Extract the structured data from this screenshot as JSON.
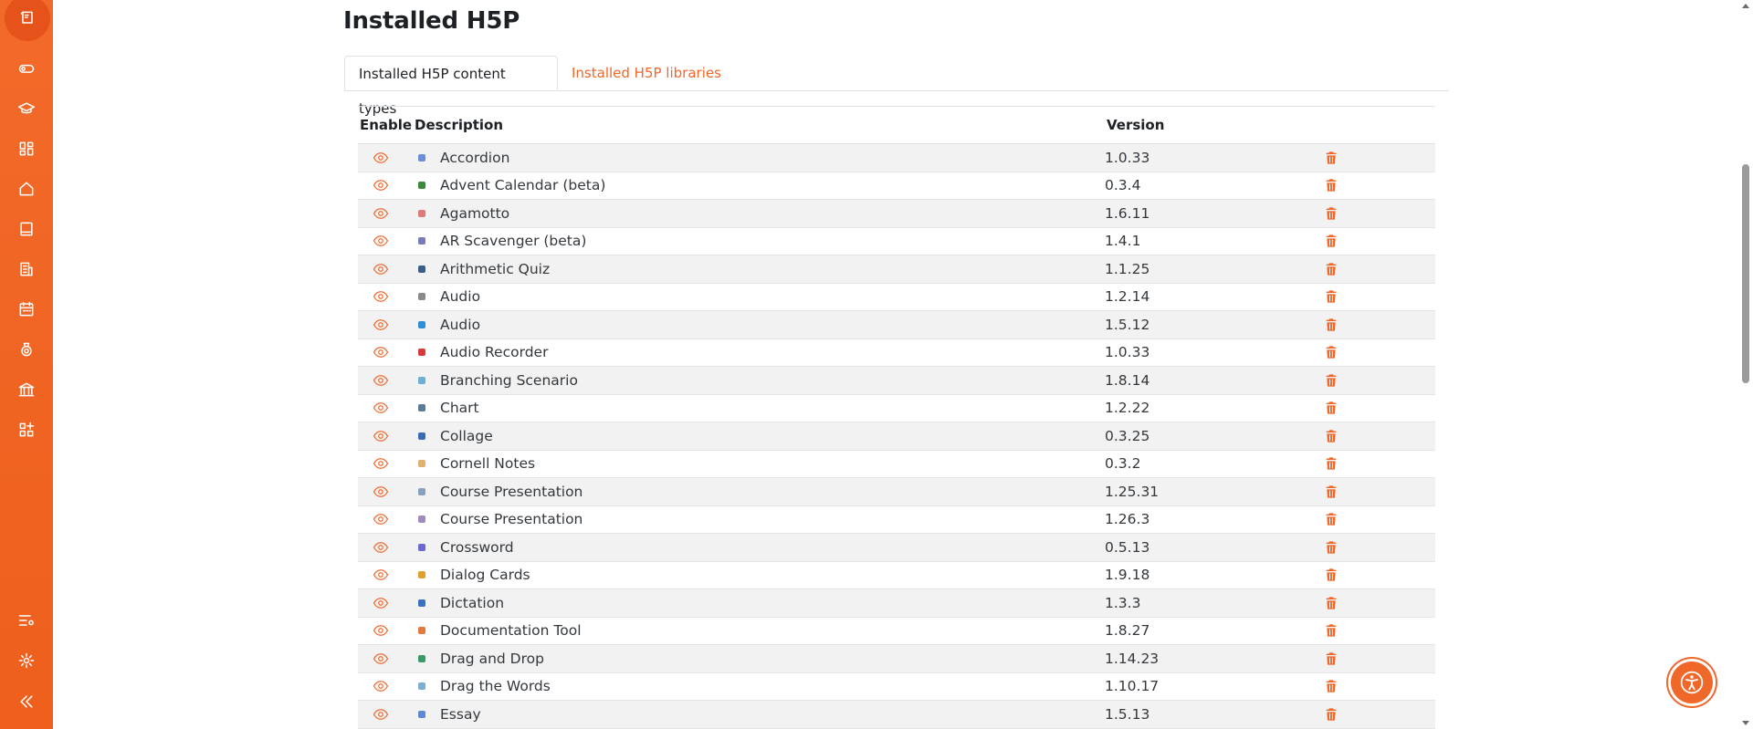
{
  "page": {
    "title": "Installed H5P"
  },
  "tabs": [
    {
      "label": "Installed H5P content types",
      "active": true
    },
    {
      "label": "Installed H5P libraries",
      "active": false
    }
  ],
  "table": {
    "headers": {
      "enable": "Enable",
      "description": "Description",
      "version": "Version"
    },
    "rows": [
      {
        "description": "Accordion",
        "version": "1.0.33",
        "icon_color": "#6b8fd6"
      },
      {
        "description": "Advent Calendar (beta)",
        "version": "0.3.4",
        "icon_color": "#3a8a3a"
      },
      {
        "description": "Agamotto",
        "version": "1.6.11",
        "icon_color": "#e07a7a"
      },
      {
        "description": "AR Scavenger (beta)",
        "version": "1.4.1",
        "icon_color": "#7a7ab8"
      },
      {
        "description": "Arithmetic Quiz",
        "version": "1.1.25",
        "icon_color": "#3b5f8a"
      },
      {
        "description": "Audio",
        "version": "1.2.14",
        "icon_color": "#8a8a8a"
      },
      {
        "description": "Audio",
        "version": "1.5.12",
        "icon_color": "#2f8fd6"
      },
      {
        "description": "Audio Recorder",
        "version": "1.0.33",
        "icon_color": "#d63a3a"
      },
      {
        "description": "Branching Scenario",
        "version": "1.8.14",
        "icon_color": "#6bb0d6"
      },
      {
        "description": "Chart",
        "version": "1.2.22",
        "icon_color": "#5a7a9a"
      },
      {
        "description": "Collage",
        "version": "0.3.25",
        "icon_color": "#3a6ab8"
      },
      {
        "description": "Cornell Notes",
        "version": "0.3.2",
        "icon_color": "#e0b070"
      },
      {
        "description": "Course Presentation",
        "version": "1.25.31",
        "icon_color": "#8aa0c0"
      },
      {
        "description": "Course Presentation",
        "version": "1.26.3",
        "icon_color": "#a08ac0"
      },
      {
        "description": "Crossword",
        "version": "0.5.13",
        "icon_color": "#6a6ad6"
      },
      {
        "description": "Dialog Cards",
        "version": "1.9.18",
        "icon_color": "#e0a030"
      },
      {
        "description": "Dictation",
        "version": "1.3.3",
        "icon_color": "#3a70c0"
      },
      {
        "description": "Documentation Tool",
        "version": "1.8.27",
        "icon_color": "#e07a40"
      },
      {
        "description": "Drag and Drop",
        "version": "1.14.23",
        "icon_color": "#3a9a6a"
      },
      {
        "description": "Drag the Words",
        "version": "1.10.17",
        "icon_color": "#7ab0d6"
      },
      {
        "description": "Essay",
        "version": "1.5.13",
        "icon_color": "#5a8ad6"
      }
    ]
  },
  "sidebar": {
    "icons": [
      "content-bank-icon",
      "toggle-icon",
      "graduation-cap-icon",
      "dashboard-grid-icon",
      "home-icon",
      "book-icon",
      "reports-icon",
      "calendar-icon",
      "badge-icon",
      "institution-icon",
      "apps-icon",
      "settings-list-icon",
      "gear-icon",
      "collapse-icon"
    ]
  },
  "colors": {
    "accent": "#f0672a",
    "sidebar": "#f0672a",
    "row_stripe": "#f2f2f2"
  }
}
